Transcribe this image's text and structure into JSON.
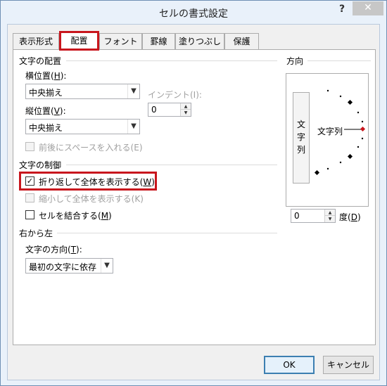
{
  "window": {
    "title": "セルの書式設定",
    "help_label": "?",
    "close_label": "✕"
  },
  "tabs": [
    {
      "label": "表示形式"
    },
    {
      "label": "配置"
    },
    {
      "label": "フォント"
    },
    {
      "label": "罫線"
    },
    {
      "label": "塗りつぶし"
    },
    {
      "label": "保護"
    }
  ],
  "active_tab": "配置",
  "text_alignment": {
    "title": "文字の配置",
    "horizontal": {
      "label_pre": "横位置(",
      "key": "H",
      "label_post": "):",
      "value": "中央揃え"
    },
    "indent": {
      "label": "インデント(I):",
      "value": "0"
    },
    "vertical": {
      "label_pre": "縦位置(",
      "key": "V",
      "label_post": "):",
      "value": "中央揃え"
    },
    "justify_distributed": {
      "label": "前後にスペースを入れる(E)",
      "checked": false,
      "enabled": false
    }
  },
  "text_control": {
    "title": "文字の制御",
    "wrap_text": {
      "label_pre": "折り返して全体を表示する(",
      "key": "W",
      "label_post": ")",
      "checked": true
    },
    "shrink_to_fit": {
      "label": "縮小して全体を表示する(K)",
      "checked": false,
      "enabled": false
    },
    "merge_cells": {
      "label_pre": "セルを結合する(",
      "key": "M",
      "label_post": ")",
      "checked": false
    }
  },
  "rtl": {
    "title": "右から左",
    "direction": {
      "label_pre": "文字の方向(",
      "key": "T",
      "label_post": "):",
      "value": "最初の文字に依存"
    }
  },
  "orientation": {
    "title": "方向",
    "vertical_text": [
      "文",
      "字",
      "列"
    ],
    "dial_text": "文字列",
    "degrees_value": "0",
    "degrees_label_pre": "度(",
    "degrees_key": "D",
    "degrees_label_post": ")"
  },
  "buttons": {
    "ok": "OK",
    "cancel": "キャンセル"
  },
  "colors": {
    "highlight": "#c8161d",
    "dial_marker": "#c8161d",
    "title_bar": "#e9f1fa"
  }
}
